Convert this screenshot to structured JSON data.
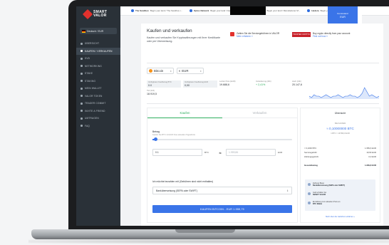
{
  "app": {
    "logo_line1": "SMART",
    "logo_line2": "VALOR"
  },
  "language_selector": {
    "label": "Deutsch / EUR"
  },
  "sidebar": {
    "items": [
      {
        "label": "ÜBERSICHT"
      },
      {
        "label": "KAUFEN / VERKAUFEN"
      },
      {
        "label": "SVD"
      },
      {
        "label": "NETWORKING"
      },
      {
        "label": "STAKE"
      },
      {
        "label": "STAKING"
      },
      {
        "label": "MEIN WALLET"
      },
      {
        "label": "VALOR TOKEN"
      },
      {
        "label": "TRADER COMMIT"
      },
      {
        "label": "INVITE A FRIEND"
      },
      {
        "label": "UMTRAGEN"
      },
      {
        "label": "FAQ"
      }
    ],
    "active_index": 1
  },
  "browser_tabs": [
    {
      "title": "The Sandbox",
      "desc": "Begin your land / The Sandbox i..."
    },
    {
      "title": "Optus Network",
      "desc": "Begin your land / Optus Netw..."
    },
    {
      "title": "Vault Network",
      "desc": "Begin your land / Manufacturer M..."
    },
    {
      "title": "Hedera",
      "desc": "Begin y..."
    }
  ],
  "top_right": {
    "line1": "Kontostand",
    "line2": "EUR"
  },
  "page": {
    "title": "Kaufen und verkaufen",
    "subtitle": "Kaufen und verkaufen Sie Kryptowährungen mit Ihrer Kreditkarte oder per Überweisung."
  },
  "promo_cards": [
    {
      "title": "Zahlen Sie die Servicegebühren in VALOR",
      "link": "Mehr erfahren »"
    },
    {
      "seal": "TRUSTED CRYPTO",
      "title": "Buy crypto directly from your account",
      "link": "Find out how »"
    }
  ],
  "asset_selector": {
    "asset": "Bitcoin",
    "currency": "EUR"
  },
  "stats": [
    {
      "label": "Verfügbarer Kaufbetrag BTC",
      "value": "0.0"
    },
    {
      "label": "Verfügbarer Kaufbetrag EUR",
      "value": "0,00"
    },
    {
      "label": "Letzter Preis (EUR)",
      "value": "19.688,6"
    },
    {
      "label": "Veränderung (24h)",
      "value": "+ 2,41%"
    },
    {
      "label": "Hoch (24h)",
      "value": "20.147,6"
    }
  ],
  "extra_stat": {
    "label": "Tief (24h)",
    "value": "18.919,5"
  },
  "sparkline": [
    12,
    11,
    13,
    12,
    12,
    11,
    12,
    13,
    12,
    11,
    12,
    12,
    13,
    12,
    11,
    12,
    12,
    13,
    12,
    12,
    11,
    12,
    14,
    18,
    15,
    12,
    13,
    12,
    11,
    12
  ],
  "trade": {
    "tab_buy": "Kaufen",
    "tab_sell": "Verkaufen",
    "amount_label": "Betrag",
    "amount_hint": "Kaufen Sie BTC mit EUR ihres aktuellen Tageslimits",
    "slider_value": 0.02,
    "btc_value": "0.1",
    "btc_unit": "BTC",
    "swap_glyph": "⇆",
    "eur_value": "1.959,86",
    "eur_unit": "EUR",
    "method_label": "Ich möchte bezahlen mit (Gebühren sind nicht enthalten)",
    "method_value": "Banküberweisung (SEPA oder SWIFT)",
    "buy_button": "KAUFEN BITCOIN - EUR 1.959,79"
  },
  "summary": {
    "title": "Übersicht",
    "receive_label": "SIE KAUFEN",
    "amount": "≈ 0,10000000 BTC",
    "rate": "1 BTC = 19.596,0 EUR",
    "rows": [
      {
        "label": "≈ 0,1000 BTC",
        "value": "1.959,6 EUR"
      },
      {
        "label": "Servicegebühr",
        "value": "19,60 EUR"
      },
      {
        "label": "Zahlungsgebühr",
        "value": "0,0 EUR"
      },
      {
        "label": "Gesamtbetrag",
        "value": "1.959,8 EUR"
      }
    ],
    "steps": [
      {
        "title": "Zahlung Bispo",
        "desc": "Banküberweisung (SEPA oder SWIFT)"
      },
      {
        "title": "Geld erhalten bei",
        "desc": "SMART VALOR"
      },
      {
        "title": "Einzahlung zum aktuellen Preis an",
        "desc": "BTC Wallet"
      }
    ],
    "link": "Mehr über die Gebühren erfahren »"
  },
  "colors": {
    "accent": "#3a74e8",
    "positive": "#2eae5f",
    "brand": "#e2312d",
    "sidebar": "#2a3138"
  }
}
